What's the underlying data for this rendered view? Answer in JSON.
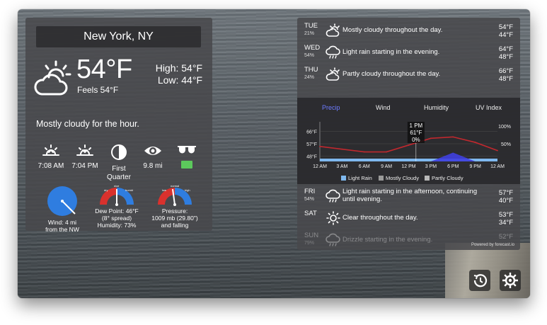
{
  "location": "New York, NY",
  "current": {
    "temp": "54°F",
    "feels_like": "Feels 54°F",
    "high": "High: 54°F",
    "low": "Low: 44°F",
    "summary": "Mostly cloudy for the hour."
  },
  "details": {
    "sunrise": "7:08 AM",
    "sunset": "7:04 PM",
    "moon_line1": "First",
    "moon_line2": "Quarter",
    "visibility": "9.8 mi",
    "uv_color": "#5cc85c"
  },
  "wind": {
    "line1": "Wind: 4 mi",
    "line2": "from the NW"
  },
  "dew": {
    "line1": "Dew Point: 46°F",
    "line2": "(8° spread)",
    "line3": "Humidity: 73%",
    "scale": [
      "dry",
      "nice",
      "humid"
    ]
  },
  "pressure": {
    "line1": "Pressure:",
    "line2": "1009 mb (29.80\")",
    "line3": "and falling",
    "scale": [
      "low",
      "normal",
      "high"
    ]
  },
  "forecast_top": [
    {
      "day": "TUE",
      "pct": "21%",
      "icon": "cloud-sun-icon",
      "summary": "Mostly cloudy throughout the day.",
      "high": "54°F",
      "low": "44°F"
    },
    {
      "day": "WED",
      "pct": "54%",
      "icon": "cloud-rain-icon",
      "summary": "Light rain starting in the evening.",
      "high": "64°F",
      "low": "48°F"
    },
    {
      "day": "THU",
      "pct": "24%",
      "icon": "cloud-sun-icon",
      "summary": "Partly cloudy throughout the day.",
      "high": "66°F",
      "low": "48°F"
    }
  ],
  "forecast_bottom": [
    {
      "day": "FRI",
      "pct": "54%",
      "icon": "cloud-rain-icon",
      "summary": "Light rain starting in the afternoon, continuing until evening.",
      "high": "57°F",
      "low": "40°F"
    },
    {
      "day": "SAT",
      "pct": "",
      "icon": "sun-icon",
      "summary": "Clear throughout the day.",
      "high": "53°F",
      "low": "34°F"
    },
    {
      "day": "SUN",
      "pct": "79%",
      "icon": "cloud-rain-icon",
      "summary": "Drizzle starting in the evening.",
      "high": "52°F",
      "low": ""
    }
  ],
  "tabs": [
    "Precip",
    "Wind",
    "Humidity",
    "UV Index"
  ],
  "active_tab": "Precip",
  "chart_data": {
    "type": "line",
    "x": [
      "12 AM",
      "3 AM",
      "6 AM",
      "9 AM",
      "12 PM",
      "3 PM",
      "6 PM",
      "9 PM",
      "12 AM"
    ],
    "y_ticks_left": [
      "66°F",
      "57°F",
      "48°F"
    ],
    "y_ticks_right": [
      "100%",
      "50%"
    ],
    "temperature": [
      55,
      53,
      51,
      51,
      56,
      61,
      62,
      58,
      52
    ],
    "precip_prob": [
      0,
      0,
      0,
      0,
      0,
      0,
      25,
      0,
      0
    ],
    "tooltip": {
      "time": "1 PM",
      "temp": "61°F",
      "precip": "0%"
    },
    "legend": [
      "Light Rain",
      "Mostly Cloudy",
      "Partly Cloudy"
    ],
    "colors": {
      "temp": "#c0282e",
      "precip": "#3f3fe0",
      "light_rain": "#7fb8ee",
      "mostly_cloudy": "#9a9a9a",
      "partly_cloudy": "#b8b8b8"
    }
  },
  "powered_by": "Powered by forecast.io"
}
